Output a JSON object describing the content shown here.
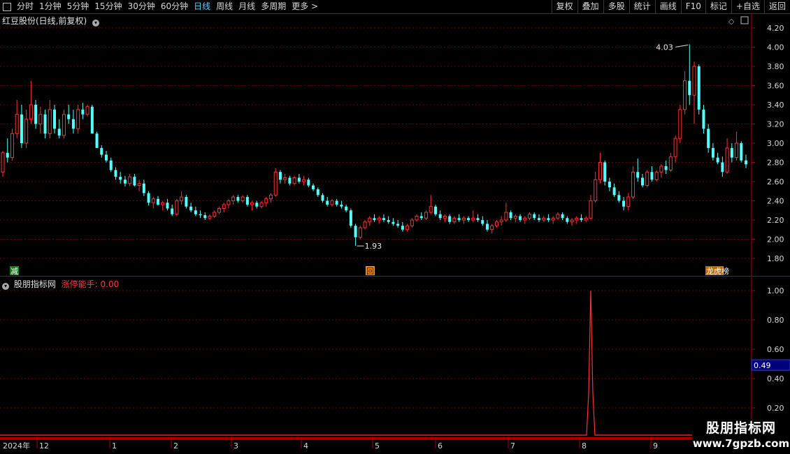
{
  "toolbar": {
    "periods": [
      "分时",
      "1分钟",
      "5分钟",
      "15分钟",
      "30分钟",
      "60分钟",
      "日线",
      "周线",
      "月线",
      "多周期",
      "更多 >"
    ],
    "active_period": "日线",
    "actions": [
      "复权",
      "叠加",
      "多股",
      "统计",
      "画线",
      "F10",
      "标记",
      "+自选",
      "返回"
    ]
  },
  "main": {
    "title": "红豆股份(日线,前复权)",
    "price_axis": [
      "4.20",
      "4.00",
      "3.80",
      "3.60",
      "3.40",
      "3.20",
      "3.00",
      "2.80",
      "2.60",
      "2.40",
      "2.20",
      "2.00",
      "1.80"
    ],
    "high_label": "4.03",
    "low_label": "1.93",
    "markers": [
      {
        "text": "减",
        "bg": "#1a7a1a",
        "color": "#ffffff"
      },
      {
        "text": "回",
        "bg": "#ff8c1a",
        "color": "#000000"
      },
      {
        "text": "龙虎榜",
        "bg": "#c26a00",
        "color": "#ffffff"
      }
    ]
  },
  "sub": {
    "title": "股朋指标网",
    "indicator_label": "涨停能手: 0.00",
    "value_axis": [
      "1.00",
      "0.80",
      "0.60",
      "0.40",
      "0.20"
    ],
    "current_value": "0.49"
  },
  "time_axis": [
    "2024年",
    "12",
    "1",
    "2",
    "3",
    "4",
    "5",
    "6",
    "7",
    "8",
    "9"
  ],
  "watermark": {
    "line1": "股朋指标网",
    "line2": "www.7gpzb.com"
  },
  "colors": {
    "up": "#ff3232",
    "down": "#54ffff",
    "grid": "#6b0000",
    "axis": "#b00000",
    "highlight_box": "#00007a"
  },
  "chart_data": {
    "type": "candlestick",
    "ylim": [
      1.7,
      4.25
    ],
    "high": 4.03,
    "low": 1.93,
    "ohlc": [
      [
        2.7,
        2.92,
        2.65,
        2.9
      ],
      [
        2.9,
        3.05,
        2.8,
        2.85
      ],
      [
        2.85,
        3.15,
        2.82,
        3.1
      ],
      [
        3.1,
        3.45,
        3.05,
        3.3
      ],
      [
        3.3,
        3.4,
        2.95,
        3.0
      ],
      [
        3.0,
        3.35,
        2.95,
        3.25
      ],
      [
        3.25,
        3.65,
        3.2,
        3.4
      ],
      [
        3.4,
        3.45,
        3.15,
        3.2
      ],
      [
        3.2,
        3.38,
        3.1,
        3.3
      ],
      [
        3.3,
        3.35,
        3.05,
        3.1
      ],
      [
        3.1,
        3.45,
        3.05,
        3.35
      ],
      [
        3.35,
        3.4,
        3.1,
        3.15
      ],
      [
        3.15,
        3.25,
        3.05,
        3.08
      ],
      [
        3.08,
        3.35,
        3.05,
        3.3
      ],
      [
        3.3,
        3.4,
        3.2,
        3.25
      ],
      [
        3.25,
        3.35,
        3.1,
        3.15
      ],
      [
        3.15,
        3.4,
        3.1,
        3.35
      ],
      [
        3.35,
        3.42,
        3.25,
        3.3
      ],
      [
        3.3,
        3.4,
        3.28,
        3.38
      ],
      [
        3.38,
        3.4,
        3.2,
        3.1
      ],
      [
        3.1,
        3.12,
        2.95,
        2.95
      ],
      [
        2.95,
        2.98,
        2.85,
        2.88
      ],
      [
        2.88,
        2.92,
        2.8,
        2.82
      ],
      [
        2.82,
        2.85,
        2.7,
        2.72
      ],
      [
        2.72,
        2.75,
        2.62,
        2.65
      ],
      [
        2.65,
        2.7,
        2.58,
        2.62
      ],
      [
        2.62,
        2.66,
        2.55,
        2.58
      ],
      [
        2.58,
        2.68,
        2.55,
        2.65
      ],
      [
        2.65,
        2.68,
        2.55,
        2.56
      ],
      [
        2.56,
        2.62,
        2.5,
        2.58
      ],
      [
        2.58,
        2.62,
        2.45,
        2.48
      ],
      [
        2.48,
        2.5,
        2.35,
        2.38
      ],
      [
        2.38,
        2.44,
        2.32,
        2.42
      ],
      [
        2.42,
        2.45,
        2.35,
        2.36
      ],
      [
        2.36,
        2.4,
        2.3,
        2.38
      ],
      [
        2.38,
        2.42,
        2.3,
        2.32
      ],
      [
        2.32,
        2.36,
        2.24,
        2.26
      ],
      [
        2.26,
        2.42,
        2.24,
        2.4
      ],
      [
        2.4,
        2.5,
        2.36,
        2.44
      ],
      [
        2.44,
        2.46,
        2.32,
        2.34
      ],
      [
        2.34,
        2.38,
        2.28,
        2.3
      ],
      [
        2.3,
        2.34,
        2.24,
        2.26
      ],
      [
        2.26,
        2.3,
        2.22,
        2.25
      ],
      [
        2.25,
        2.28,
        2.2,
        2.22
      ],
      [
        2.22,
        2.26,
        2.2,
        2.24
      ],
      [
        2.24,
        2.3,
        2.22,
        2.28
      ],
      [
        2.28,
        2.34,
        2.26,
        2.32
      ],
      [
        2.32,
        2.38,
        2.28,
        2.36
      ],
      [
        2.36,
        2.42,
        2.32,
        2.4
      ],
      [
        2.4,
        2.46,
        2.36,
        2.44
      ],
      [
        2.44,
        2.46,
        2.38,
        2.4
      ],
      [
        2.4,
        2.46,
        2.38,
        2.44
      ],
      [
        2.44,
        2.46,
        2.34,
        2.36
      ],
      [
        2.36,
        2.4,
        2.3,
        2.38
      ],
      [
        2.38,
        2.4,
        2.32,
        2.34
      ],
      [
        2.34,
        2.4,
        2.32,
        2.38
      ],
      [
        2.38,
        2.44,
        2.34,
        2.42
      ],
      [
        2.42,
        2.48,
        2.38,
        2.46
      ],
      [
        2.46,
        2.74,
        2.44,
        2.7
      ],
      [
        2.7,
        2.72,
        2.58,
        2.62
      ],
      [
        2.62,
        2.68,
        2.58,
        2.64
      ],
      [
        2.64,
        2.66,
        2.56,
        2.58
      ],
      [
        2.58,
        2.66,
        2.56,
        2.64
      ],
      [
        2.64,
        2.68,
        2.58,
        2.6
      ],
      [
        2.6,
        2.66,
        2.56,
        2.62
      ],
      [
        2.62,
        2.64,
        2.54,
        2.56
      ],
      [
        2.56,
        2.58,
        2.5,
        2.52
      ],
      [
        2.52,
        2.54,
        2.44,
        2.46
      ],
      [
        2.46,
        2.48,
        2.38,
        2.4
      ],
      [
        2.4,
        2.44,
        2.34,
        2.36
      ],
      [
        2.36,
        2.42,
        2.34,
        2.4
      ],
      [
        2.4,
        2.42,
        2.34,
        2.36
      ],
      [
        2.36,
        2.4,
        2.32,
        2.34
      ],
      [
        2.34,
        2.36,
        2.28,
        2.3
      ],
      [
        2.3,
        2.32,
        2.12,
        2.14
      ],
      [
        2.14,
        2.16,
        1.93,
        2.02
      ],
      [
        2.02,
        2.14,
        2.0,
        2.12
      ],
      [
        2.12,
        2.2,
        2.1,
        2.18
      ],
      [
        2.18,
        2.24,
        2.14,
        2.22
      ],
      [
        2.22,
        2.26,
        2.18,
        2.2
      ],
      [
        2.2,
        2.24,
        2.16,
        2.22
      ],
      [
        2.22,
        2.26,
        2.18,
        2.2
      ],
      [
        2.2,
        2.24,
        2.16,
        2.18
      ],
      [
        2.18,
        2.22,
        2.14,
        2.16
      ],
      [
        2.16,
        2.2,
        2.12,
        2.14
      ],
      [
        2.14,
        2.18,
        2.08,
        2.1
      ],
      [
        2.1,
        2.16,
        2.08,
        2.14
      ],
      [
        2.14,
        2.22,
        2.12,
        2.2
      ],
      [
        2.2,
        2.26,
        2.18,
        2.24
      ],
      [
        2.24,
        2.28,
        2.2,
        2.22
      ],
      [
        2.22,
        2.3,
        2.2,
        2.28
      ],
      [
        2.28,
        2.46,
        2.26,
        2.34
      ],
      [
        2.34,
        2.36,
        2.24,
        2.26
      ],
      [
        2.26,
        2.3,
        2.2,
        2.22
      ],
      [
        2.22,
        2.26,
        2.18,
        2.24
      ],
      [
        2.24,
        2.26,
        2.16,
        2.18
      ],
      [
        2.18,
        2.24,
        2.16,
        2.22
      ],
      [
        2.22,
        2.26,
        2.18,
        2.2
      ],
      [
        2.2,
        2.24,
        2.16,
        2.22
      ],
      [
        2.22,
        2.24,
        2.18,
        2.2
      ],
      [
        2.2,
        2.3,
        2.18,
        2.22
      ],
      [
        2.22,
        2.26,
        2.18,
        2.2
      ],
      [
        2.2,
        2.24,
        2.14,
        2.16
      ],
      [
        2.16,
        2.2,
        2.08,
        2.1
      ],
      [
        2.1,
        2.16,
        2.06,
        2.14
      ],
      [
        2.14,
        2.2,
        2.12,
        2.18
      ],
      [
        2.18,
        2.24,
        2.14,
        2.2
      ],
      [
        2.2,
        2.38,
        2.18,
        2.28
      ],
      [
        2.28,
        2.3,
        2.2,
        2.22
      ],
      [
        2.22,
        2.26,
        2.18,
        2.24
      ],
      [
        2.24,
        2.26,
        2.18,
        2.2
      ],
      [
        2.2,
        2.24,
        2.16,
        2.22
      ],
      [
        2.22,
        2.28,
        2.2,
        2.26
      ],
      [
        2.26,
        2.28,
        2.2,
        2.22
      ],
      [
        2.22,
        2.26,
        2.18,
        2.2
      ],
      [
        2.2,
        2.24,
        2.18,
        2.22
      ],
      [
        2.22,
        2.26,
        2.18,
        2.2
      ],
      [
        2.2,
        2.24,
        2.16,
        2.22
      ],
      [
        2.22,
        2.28,
        2.2,
        2.26
      ],
      [
        2.26,
        2.28,
        2.2,
        2.22
      ],
      [
        2.22,
        2.24,
        2.16,
        2.18
      ],
      [
        2.18,
        2.22,
        2.14,
        2.2
      ],
      [
        2.2,
        2.24,
        2.16,
        2.22
      ],
      [
        2.22,
        2.26,
        2.18,
        2.2
      ],
      [
        2.2,
        2.24,
        2.18,
        2.22
      ],
      [
        2.22,
        2.46,
        2.2,
        2.4
      ],
      [
        2.4,
        2.7,
        2.38,
        2.62
      ],
      [
        2.62,
        2.9,
        2.58,
        2.8
      ],
      [
        2.8,
        2.82,
        2.56,
        2.6
      ],
      [
        2.6,
        2.64,
        2.5,
        2.54
      ],
      [
        2.54,
        2.58,
        2.44,
        2.46
      ],
      [
        2.46,
        2.5,
        2.38,
        2.4
      ],
      [
        2.4,
        2.44,
        2.3,
        2.34
      ],
      [
        2.34,
        2.48,
        2.3,
        2.44
      ],
      [
        2.44,
        2.76,
        2.42,
        2.7
      ],
      [
        2.7,
        2.84,
        2.6,
        2.64
      ],
      [
        2.64,
        2.68,
        2.54,
        2.56
      ],
      [
        2.56,
        2.72,
        2.54,
        2.7
      ],
      [
        2.7,
        2.76,
        2.6,
        2.62
      ],
      [
        2.62,
        2.72,
        2.6,
        2.7
      ],
      [
        2.7,
        2.78,
        2.64,
        2.76
      ],
      [
        2.76,
        2.82,
        2.68,
        2.72
      ],
      [
        2.72,
        2.9,
        2.7,
        2.86
      ],
      [
        2.86,
        3.08,
        2.8,
        3.05
      ],
      [
        3.05,
        3.4,
        3.0,
        3.35
      ],
      [
        3.35,
        3.75,
        3.3,
        3.65
      ],
      [
        3.65,
        4.03,
        3.4,
        3.5
      ],
      [
        3.5,
        3.85,
        3.2,
        3.8
      ],
      [
        3.8,
        3.82,
        3.3,
        3.35
      ],
      [
        3.35,
        3.4,
        3.1,
        3.15
      ],
      [
        3.15,
        3.2,
        2.9,
        2.95
      ],
      [
        2.95,
        3.0,
        2.82,
        2.85
      ],
      [
        2.85,
        2.9,
        2.78,
        2.8
      ],
      [
        2.8,
        2.86,
        2.65,
        2.7
      ],
      [
        2.7,
        3.05,
        2.68,
        2.95
      ],
      [
        2.95,
        3.0,
        2.8,
        2.85
      ],
      [
        2.85,
        3.12,
        2.82,
        3.0
      ],
      [
        3.0,
        3.02,
        2.8,
        2.82
      ],
      [
        2.82,
        2.88,
        2.74,
        2.78
      ]
    ],
    "indicator_peak_index": 125,
    "indicator_peak_value": 1.0
  }
}
